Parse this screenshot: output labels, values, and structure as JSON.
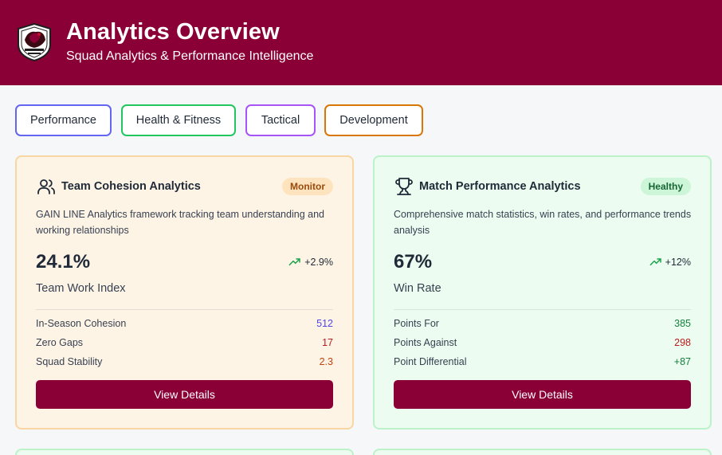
{
  "header": {
    "title": "Analytics Overview",
    "subtitle": "Squad Analytics & Performance Intelligence",
    "brand_color": "#8a0036"
  },
  "tabs": [
    {
      "label": "Performance",
      "color": "#6366f1"
    },
    {
      "label": "Health & Fitness",
      "color": "#22c55e"
    },
    {
      "label": "Tactical",
      "color": "#a855f7"
    },
    {
      "label": "Development",
      "color": "#d97706"
    }
  ],
  "cards": [
    {
      "icon": "users-icon",
      "title": "Team Cohesion Analytics",
      "badge": "Monitor",
      "description": "GAIN LINE Analytics framework tracking team understanding and working relationships",
      "value": "24.1%",
      "trend": "+2.9%",
      "metric_label": "Team Work Index",
      "rows": [
        {
          "label": "In-Season Cohesion",
          "value": "512",
          "color": "#4f46e5"
        },
        {
          "label": "Zero Gaps",
          "value": "17",
          "color": "#b91c1c"
        },
        {
          "label": "Squad Stability",
          "value": "2.3",
          "color": "#c2410c"
        }
      ],
      "button": "View Details"
    },
    {
      "icon": "trophy-icon",
      "title": "Match Performance Analytics",
      "badge": "Healthy",
      "description": "Comprehensive match statistics, win rates, and performance trends analysis",
      "value": "67%",
      "trend": "+12%",
      "metric_label": "Win Rate",
      "rows": [
        {
          "label": "Points For",
          "value": "385",
          "color": "#15803d"
        },
        {
          "label": "Points Against",
          "value": "298",
          "color": "#b91c1c"
        },
        {
          "label": "Point Differential",
          "value": "+87",
          "color": "#15803d"
        }
      ],
      "button": "View Details"
    }
  ],
  "trend_color": "#16a34a"
}
